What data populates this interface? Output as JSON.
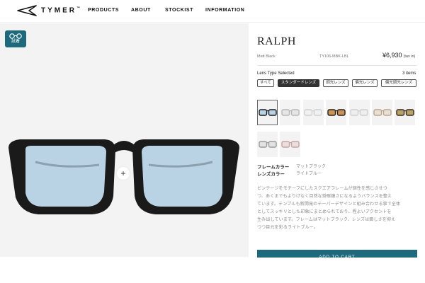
{
  "brand": {
    "name": "TYMER",
    "tm": "™"
  },
  "nav": [
    "PRODUCTS",
    "ABOUT",
    "STOCKIST",
    "INFORMATION"
  ],
  "tryon": {
    "label": "試着",
    "icon": "glasses-icon"
  },
  "zoom": {
    "symbol": "+"
  },
  "product": {
    "name": "RALPH",
    "color_name": "Matt Black",
    "sku": "TY106-MBK-LBL",
    "price": "¥6,930",
    "tax": "(tax in)"
  },
  "lens": {
    "label": "Lens Type Selected",
    "count": "3 items",
    "filters": [
      {
        "label": "すべて",
        "active": false
      },
      {
        "label": "スタンダードレンズ",
        "active": true
      },
      {
        "label": "調光レンズ",
        "active": false
      },
      {
        "label": "偏光レンズ",
        "active": false
      },
      {
        "label": "偏光調光レンズ",
        "active": false
      }
    ]
  },
  "swatches": [
    {
      "frame": "#1a1a1a",
      "lens": "#b9d4e6",
      "selected": true
    },
    {
      "frame": "#b8b8b8",
      "lens": "#e6e6e6",
      "selected": false
    },
    {
      "frame": "#d0d0d0",
      "lens": "#f1f1f1",
      "selected": false
    },
    {
      "frame": "#2a1f18",
      "lens": "#c9935a",
      "selected": false
    },
    {
      "frame": "#cfcfcf",
      "lens": "#eeeeee",
      "selected": false
    },
    {
      "frame": "#bca48a",
      "lens": "#e7e1d8",
      "selected": false
    },
    {
      "frame": "#3a2a1c",
      "lens": "#b8a36a",
      "selected": false
    },
    {
      "frame": "#9a9a9a",
      "lens": "#e2e2e2",
      "selected": false
    },
    {
      "frame": "#c7a3a3",
      "lens": "#eddede",
      "selected": false
    }
  ],
  "specs": [
    {
      "label": "フレームカラー",
      "value": "マットブラック"
    },
    {
      "label": "レンズカラー",
      "value": "ライトブルー"
    }
  ],
  "description": [
    "ビンテージをモチーフにしたスクエアフレームが個性を感じさせつ",
    "つ、あくまでもよりげなく目然な掛眼鏡さになるようバランスを整え",
    "ています。テンプルも新開発のテーパーデザインと組み合わせる事で全体",
    "としてスッキリとした印象にまとめられており、程よいアクセントを",
    "生み出しています。フレームはマットブラック、レンズは面しさを抑え",
    "つつ目元を彩るライトブルー。"
  ],
  "cart": {
    "label": "ADD TO CART"
  }
}
